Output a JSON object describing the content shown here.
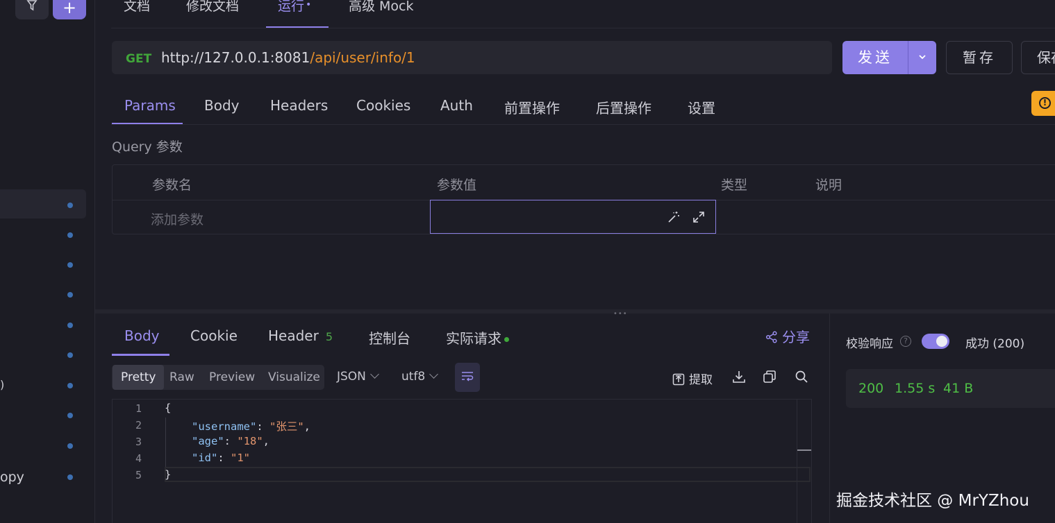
{
  "top_tabs": [
    {
      "label": "文档"
    },
    {
      "label": "修改文档"
    },
    {
      "label": "运行",
      "dot": "•"
    },
    {
      "label": "高级 Mock"
    }
  ],
  "sidebar": {
    "partial_text_1": ")",
    "partial_text_2": "opy"
  },
  "request": {
    "method": "GET",
    "url_host": "http://127.0.0.1:8081",
    "url_path": "/api/user/info/1",
    "send_label": "发送",
    "save_draft_label": "暂存",
    "save_label": "保存"
  },
  "request_tabs": [
    "Params",
    "Body",
    "Headers",
    "Cookies",
    "Auth",
    "前置操作",
    "后置操作",
    "设置"
  ],
  "query": {
    "section_label": "Query 参数",
    "columns": [
      "参数名",
      "参数值",
      "类型",
      "说明"
    ],
    "add_placeholder": "添加参数"
  },
  "response_tabs": {
    "body": "Body",
    "cookie": "Cookie",
    "header": "Header",
    "header_count": "5",
    "console": "控制台",
    "actual_request": "实际请求"
  },
  "share_label": "分享",
  "format": {
    "modes": [
      "Pretty",
      "Raw",
      "Preview",
      "Visualize"
    ],
    "type": "JSON",
    "encoding": "utf8",
    "extract_label": "提取"
  },
  "response_body": {
    "line_numbers": [
      "1",
      "2",
      "3",
      "4",
      "5"
    ],
    "open_brace": "{",
    "close_brace": "}",
    "fields": [
      {
        "key": "\"username\"",
        "value": "\"张三\"",
        "suffix": ","
      },
      {
        "key": "\"age\"",
        "value": "\"18\"",
        "suffix": ","
      },
      {
        "key": "\"id\"",
        "value": "\"1\"",
        "suffix": ""
      }
    ]
  },
  "validation": {
    "label": "校验响应",
    "help": "?",
    "result": "成功 (200)",
    "enabled": true
  },
  "stats": {
    "status": "200",
    "time": "1.55 s",
    "size": "41 B"
  },
  "watermark": "掘金技术社区 @ MrYZhou",
  "colors": {
    "accent": "#8b7ee6",
    "method_get": "#41a63a",
    "url_path": "#e8902a",
    "success": "#4fbf46",
    "warning": "#f5a623"
  }
}
